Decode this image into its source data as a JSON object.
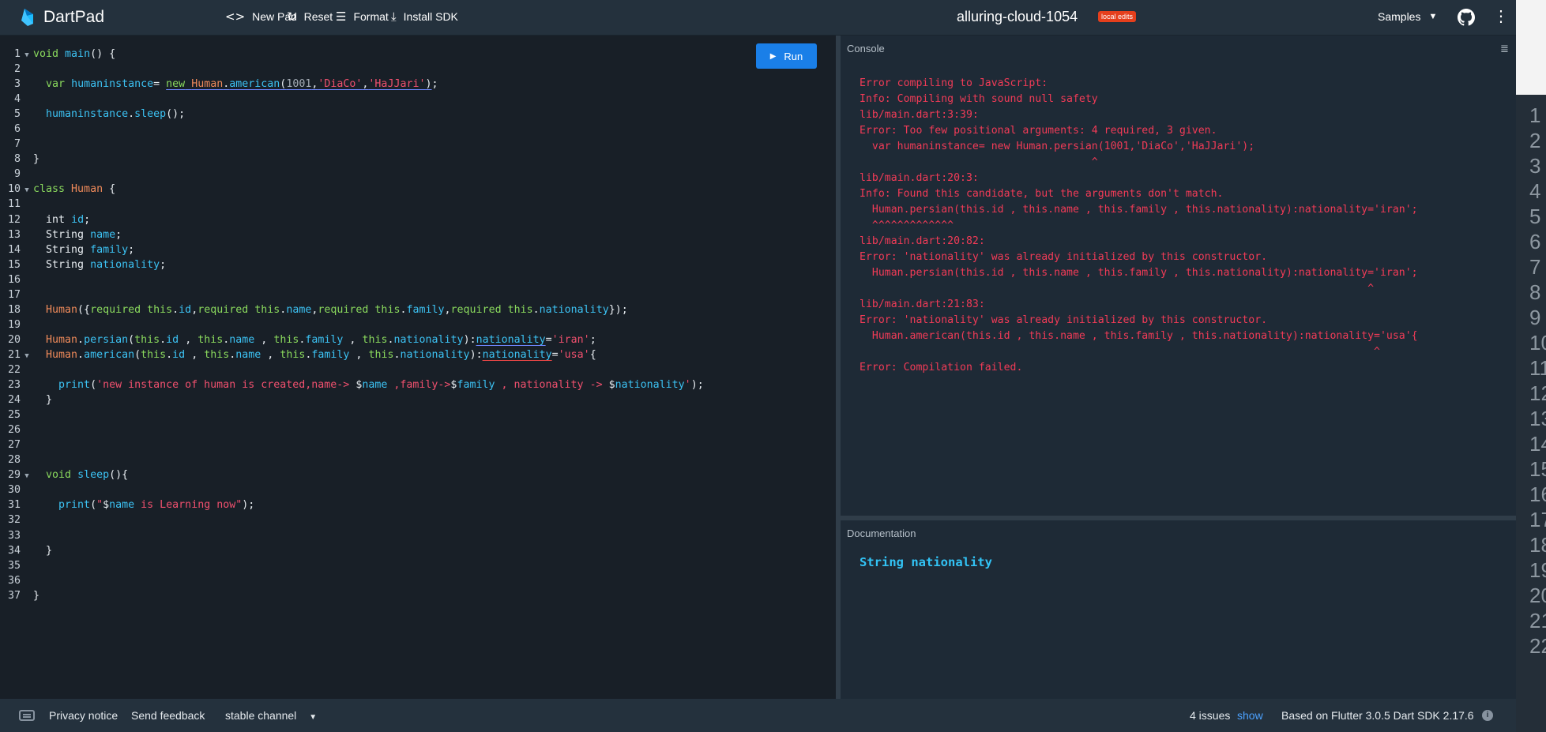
{
  "header": {
    "app_name": "DartPad",
    "buttons": {
      "new_pad": "New Pad",
      "reset": "Reset",
      "format": "Format",
      "install_sdk": "Install SDK"
    },
    "pad_title": "alluring-cloud-1054",
    "badge": "local edits",
    "samples": "Samples"
  },
  "editor": {
    "run_label": "Run"
  },
  "console": {
    "title": "Console",
    "lines": [
      "Error compiling to JavaScript:",
      "Info: Compiling with sound null safety",
      "lib/main.dart:3:39:",
      "Error: Too few positional arguments: 4 required, 3 given.",
      "  var humaninstance= new Human.persian(1001,'DiaCo','HaJJari');",
      "                                     ^",
      "lib/main.dart:20:3:",
      "Info: Found this candidate, but the arguments don't match.",
      "  Human.persian(this.id , this.name , this.family , this.nationality):nationality='iran';",
      "  ^^^^^^^^^^^^^",
      "lib/main.dart:20:82:",
      "Error: 'nationality' was already initialized by this constructor.",
      "  Human.persian(this.id , this.name , this.family , this.nationality):nationality='iran';",
      "                                                                                 ^",
      "lib/main.dart:21:83:",
      "Error: 'nationality' was already initialized by this constructor.",
      "  Human.american(this.id , this.name , this.family , this.nationality):nationality='usa'{",
      "                                                                                  ^",
      "Error: Compilation failed."
    ]
  },
  "documentation": {
    "title": "Documentation",
    "content": "String nationality"
  },
  "right_strip_numbers": [
    "1",
    "2",
    "3",
    "4",
    "5",
    "6",
    "7",
    "8",
    "9",
    "10",
    "11",
    "12",
    "13",
    "14",
    "15",
    "16",
    "17",
    "18",
    "19",
    "20",
    "21",
    "22"
  ],
  "footer": {
    "privacy": "Privacy notice",
    "feedback": "Send feedback",
    "channel": "stable channel",
    "issues": "4 issues",
    "show": "show",
    "sdk": "Based on Flutter 3.0.5 Dart SDK 2.17.6"
  },
  "colors": {
    "run_button": "#1a7fe8",
    "badge": "#e53f1c",
    "error_text": "#f13b57",
    "doc_text": "#32c3f5"
  }
}
